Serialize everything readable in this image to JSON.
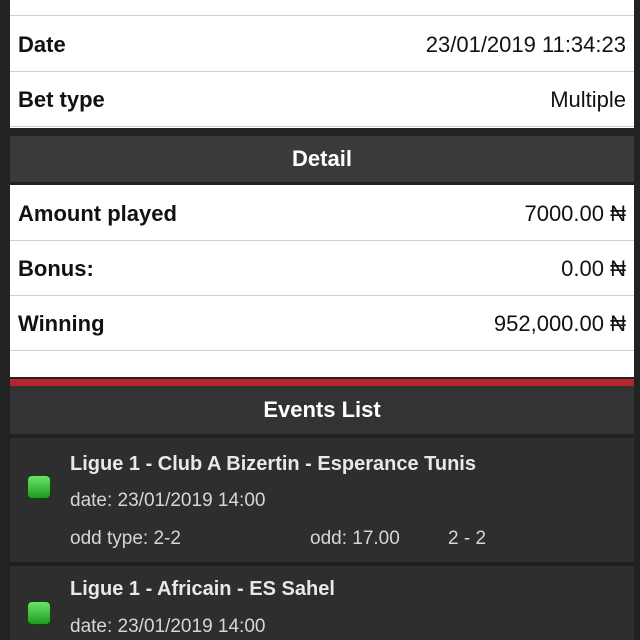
{
  "top_partial": {
    "label": "",
    "value": ""
  },
  "info": [
    {
      "label": "Date",
      "value": "23/01/2019 11:34:23"
    },
    {
      "label": "Bet type",
      "value": "Multiple"
    }
  ],
  "detail_header": "Detail",
  "detail": [
    {
      "label": "Amount played",
      "value": "7000.00 ₦"
    },
    {
      "label": "Bonus:",
      "value": "0.00 ₦"
    },
    {
      "label": "Winning",
      "value": "952,000.00 ₦"
    }
  ],
  "events_header": "Events List",
  "events": [
    {
      "title": "Ligue 1   - Club A Bizertin - Esperance Tunis",
      "date": "date: 23/01/2019 14:00",
      "odd_type": "odd type: 2-2",
      "odd": "odd: 17.00",
      "score": "2 - 2"
    },
    {
      "title": "Ligue 1   - Africain - ES Sahel",
      "date": "date: 23/01/2019 14:00",
      "odd_type": "",
      "odd": "",
      "score": ""
    }
  ],
  "colors": {
    "status_indicator": "#2fb52f",
    "accent": "#b3262b",
    "header_bar": "#3a3a3a"
  }
}
